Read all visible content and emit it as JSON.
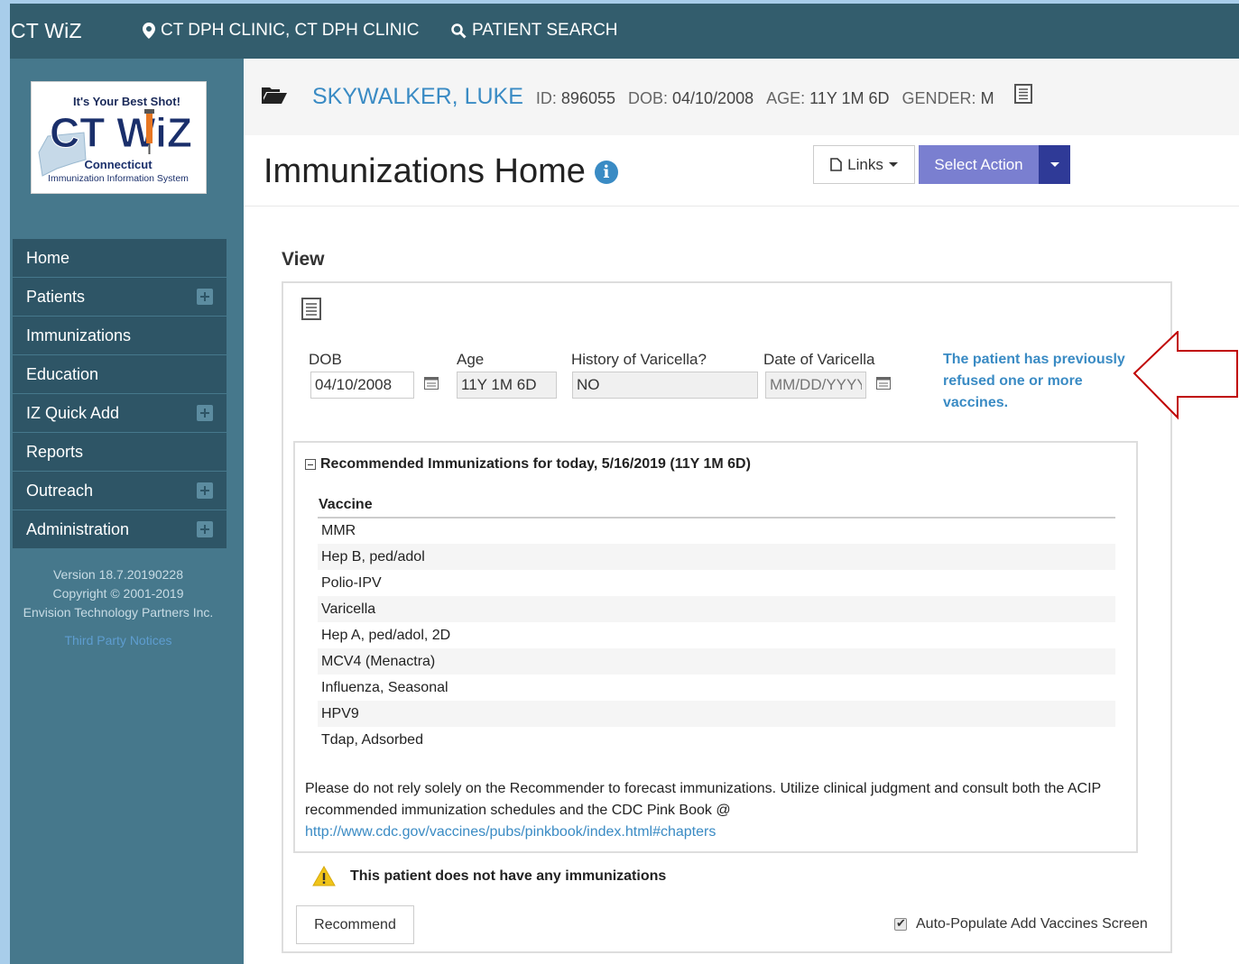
{
  "app": {
    "title": "CT WiZ",
    "clinic": "CT DPH CLINIC, CT DPH CLINIC",
    "patient_search": "PATIENT SEARCH"
  },
  "logo": {
    "tagline": "It's Your Best Shot!",
    "name": "CT WiZ",
    "state": "Connecticut",
    "system": "Immunization Information System"
  },
  "sidebar": {
    "items": [
      {
        "label": "Home",
        "expandable": false
      },
      {
        "label": "Patients",
        "expandable": true
      },
      {
        "label": "Immunizations",
        "expandable": false
      },
      {
        "label": "Education",
        "expandable": false
      },
      {
        "label": "IZ Quick Add",
        "expandable": true
      },
      {
        "label": "Reports",
        "expandable": false
      },
      {
        "label": "Outreach",
        "expandable": true
      },
      {
        "label": "Administration",
        "expandable": true
      }
    ],
    "version": "Version 18.7.20190228",
    "copyright": "Copyright © 2001-2019",
    "company": "Envision Technology Partners Inc.",
    "third_party": "Third Party Notices"
  },
  "patient": {
    "name": "SKYWALKER, LUKE",
    "id_label": "ID:",
    "id": "896055",
    "dob_label": "DOB:",
    "dob": "04/10/2008",
    "age_label": "AGE:",
    "age": "11Y 1M 6D",
    "gender_label": "GENDER:",
    "gender": "M"
  },
  "page": {
    "title": "Immunizations Home",
    "links_label": "Links",
    "action_label": "Select Action",
    "view_label": "View"
  },
  "fields": {
    "dob_label": "DOB",
    "dob_value": "04/10/2008",
    "age_label": "Age",
    "age_value": "11Y 1M 6D",
    "varicella_history_label": "History of Varicella?",
    "varicella_history_value": "NO",
    "varicella_date_label": "Date of Varicella",
    "varicella_date_placeholder": "MM/DD/YYYY"
  },
  "refused_note": "The patient has previously refused one or more vaccines.",
  "recommendations": {
    "header": "Recommended Immunizations for today, 5/16/2019 (11Y 1M 6D)",
    "column": "Vaccine",
    "vaccines": [
      "MMR",
      "Hep B, ped/adol",
      "Polio-IPV",
      "Varicella",
      "Hep A, ped/adol, 2D",
      "MCV4 (Menactra)",
      "Influenza, Seasonal",
      "HPV9",
      "Tdap, Adsorbed"
    ],
    "disclaimer": "Please do not rely solely on the Recommender to forecast immunizations. Utilize clinical judgment and consult both the ACIP recommended immunization schedules and the CDC Pink Book @",
    "link": "http://www.cdc.gov/vaccines/pubs/pinkbook/index.html#chapters"
  },
  "warning": "This patient does not have any immunizations",
  "recommend_button": "Recommend",
  "auto_populate_label": "Auto-Populate Add Vaccines Screen",
  "auto_populate_checked": true,
  "colors": {
    "topbar": "#335d6d",
    "sidebar": "#46788c",
    "nav_item": "#2e5566",
    "link_blue": "#3a8bc4",
    "action_button": "#7a7fd0",
    "action_caret": "#2f3a97",
    "arrow": "#c00000",
    "warning": "#f0c419"
  }
}
